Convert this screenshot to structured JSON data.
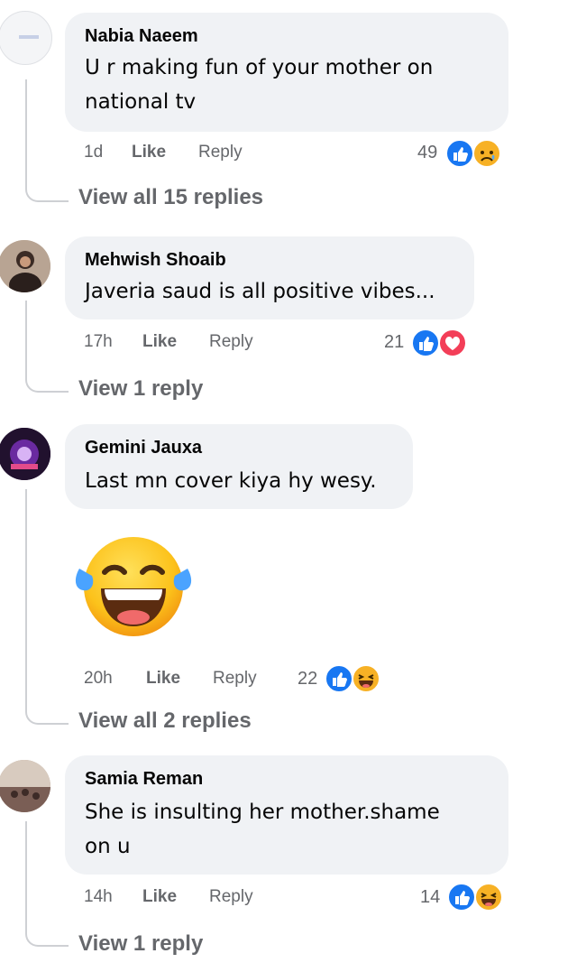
{
  "comments": [
    {
      "author": "Nabia Naeem",
      "text_line1": "U r making fun of your mother on",
      "text_line2": "national tv",
      "time": "1d",
      "like": "Like",
      "reply": "Reply",
      "reactions": "49",
      "view_replies": "View all 15 replies",
      "reaction_icons": [
        "like-icon",
        "sad-icon"
      ]
    },
    {
      "author": "Mehwish Shoaib",
      "text_line1": "Javeria saud is all positive vibes...",
      "time": "17h",
      "like": "Like",
      "reply": "Reply",
      "reactions": "21",
      "view_replies": "View 1 reply",
      "reaction_icons": [
        "like-icon",
        "love-icon"
      ]
    },
    {
      "author": "Gemini Jauxa",
      "text_line1": "Last mn cover kiya hy wesy.",
      "sticker": "tears-of-joy-emoji",
      "time": "20h",
      "like": "Like",
      "reply": "Reply",
      "reactions": "22",
      "view_replies": "View all 2 replies",
      "reaction_icons": [
        "like-icon",
        "haha-icon"
      ]
    },
    {
      "author": "Samia Reman",
      "text_line1": "She is insulting her mother.shame",
      "text_line2": "on u",
      "time": "14h",
      "like": "Like",
      "reply": "Reply",
      "reactions": "14",
      "view_replies": "View 1 reply",
      "reaction_icons": [
        "like-icon",
        "haha-icon"
      ]
    }
  ],
  "colors": {
    "bubble": "#f0f2f5",
    "meta": "#65676b",
    "like_blue": "#1877f2",
    "love_red": "#f33e58",
    "haha_yellow": "#f7b125"
  }
}
